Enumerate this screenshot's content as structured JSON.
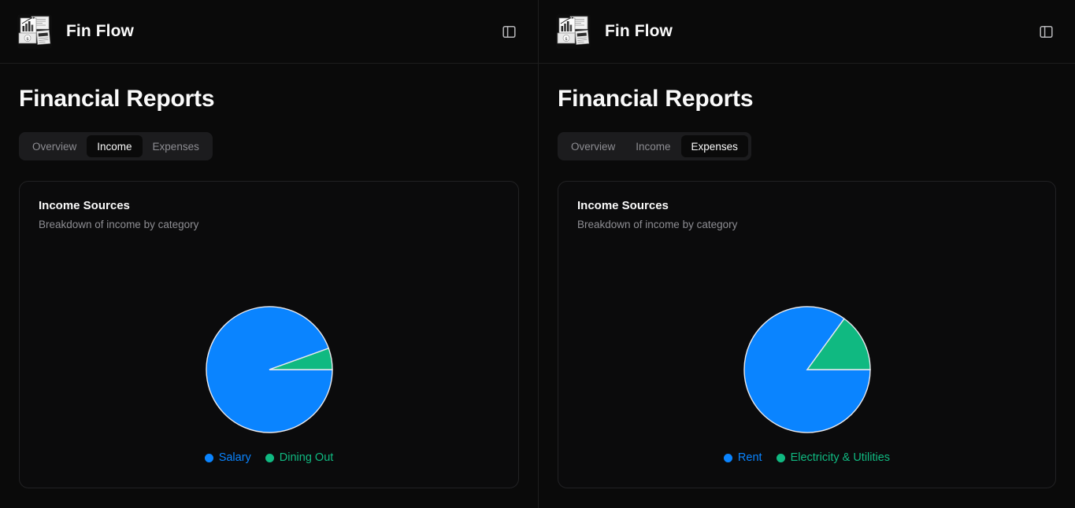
{
  "app": {
    "brand_name": "Fin Flow",
    "logo_icon": "finance-documents-logo",
    "panel_toggle_icon": "panel-left-icon"
  },
  "theme": {
    "background": "#0a0a0a",
    "card_background": "#0b0b0c",
    "border": "#222224",
    "text_primary": "#fafafa",
    "text_muted": "#8e8e93",
    "tabs_background": "#1c1c1e",
    "series_blue": "#0a84ff",
    "series_green": "#10b981"
  },
  "panes": [
    {
      "id": "left",
      "page_title": "Financial Reports",
      "tabs": [
        {
          "label": "Overview",
          "active": false
        },
        {
          "label": "Income",
          "active": true
        },
        {
          "label": "Expenses",
          "active": false
        }
      ],
      "card": {
        "title": "Income Sources",
        "subtitle": "Breakdown of income by category"
      },
      "chart_data": {
        "type": "pie",
        "title": "Income Sources",
        "subtitle": "Breakdown of income by category",
        "labels": [
          "Salary",
          "Dining Out"
        ],
        "values": [
          94.5,
          5.5
        ],
        "colors": [
          "#0a84ff",
          "#10b981"
        ],
        "start_angle_deg": 0,
        "direction": "clockwise",
        "legend": "bottom",
        "grid": false
      }
    },
    {
      "id": "right",
      "page_title": "Financial Reports",
      "tabs": [
        {
          "label": "Overview",
          "active": false
        },
        {
          "label": "Income",
          "active": false
        },
        {
          "label": "Expenses",
          "active": true
        }
      ],
      "card": {
        "title": "Income Sources",
        "subtitle": "Breakdown of income by category"
      },
      "chart_data": {
        "type": "pie",
        "title": "Income Sources",
        "subtitle": "Breakdown of income by category",
        "labels": [
          "Rent",
          "Electricity & Utilities"
        ],
        "values": [
          85,
          15
        ],
        "colors": [
          "#0a84ff",
          "#10b981"
        ],
        "start_angle_deg": 0,
        "direction": "clockwise",
        "legend": "bottom",
        "grid": false
      }
    }
  ]
}
